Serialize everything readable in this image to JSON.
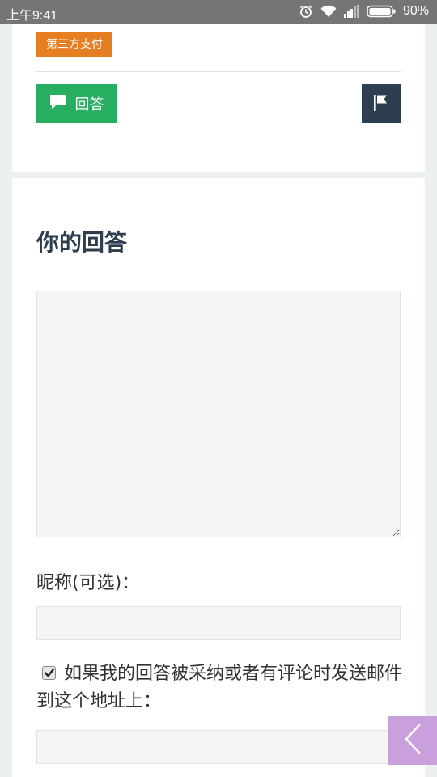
{
  "status_bar": {
    "time": "上午9:41",
    "battery": "90%"
  },
  "question": {
    "tag": "第三方支付",
    "answer_button": "回答"
  },
  "answer_form": {
    "title": "你的回答",
    "nickname_label": "昵称(可选)：",
    "notify_label": "如果我的回答被采纳或者有评论时发送邮件到这个地址上：",
    "notify_checked": true
  },
  "colors": {
    "tag": "#e67e22",
    "answer_button": "#27ae60",
    "flag_button": "#2c3e50",
    "back_button": "#c9a0dc"
  },
  "icons": [
    "alarm-icon",
    "wifi-icon",
    "signal-icon",
    "battery-icon",
    "comment-icon",
    "flag-icon",
    "chevron-left-icon",
    "checkmark-icon"
  ]
}
